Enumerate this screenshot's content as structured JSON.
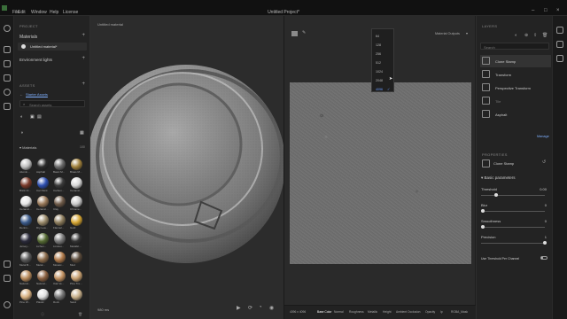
{
  "app": {
    "title": "Untitled Project*",
    "menu": [
      "File",
      "Edit",
      "Window",
      "Help",
      "License"
    ]
  },
  "left_panel": {
    "project_header": "PROJECT",
    "materials_label": "Materials",
    "material_item": "Untitled material*",
    "env_label": "Environment lights",
    "assets_header": "ASSETS",
    "breadcrumb": "Starter Assets",
    "search_placeholder": "Search assets",
    "materials_section": "Materials",
    "materials_count": "100",
    "materials": [
      {
        "name": "Alumin..."
      },
      {
        "name": "Asphalt"
      },
      {
        "name": "Basic M..."
      },
      {
        "name": "Brass M..."
      },
      {
        "name": "Brick Cl..."
      },
      {
        "name": "Car Paint"
      },
      {
        "name": "Carbon..."
      },
      {
        "name": "Ceramic..."
      },
      {
        "name": "Ceramic..."
      },
      {
        "name": "Ceramic..."
      },
      {
        "name": "Clay"
      },
      {
        "name": "Chrome..."
      },
      {
        "name": "Denim..."
      },
      {
        "name": "Dry Lea..."
      },
      {
        "name": "Flannel..."
      },
      {
        "name": "Gold"
      },
      {
        "name": "Jersey..."
      },
      {
        "name": "Lichen..."
      },
      {
        "name": "Linoleu..."
      },
      {
        "name": "Metallic..."
      },
      {
        "name": "Metal B..."
      },
      {
        "name": "Metal..."
      },
      {
        "name": "Mosaic..."
      },
      {
        "name": "Mud"
      },
      {
        "name": "Natural..."
      },
      {
        "name": "Natural..."
      },
      {
        "name": "Oak Ve..."
      },
      {
        "name": "Pine Tre..."
      },
      {
        "name": "Pine W..."
      },
      {
        "name": "Plastic"
      },
      {
        "name": "Rock"
      },
      {
        "name": "Sand"
      }
    ]
  },
  "viewport": {
    "title": "Untitled material",
    "status": "980 ms"
  },
  "toolbar": {
    "resolution": "4096",
    "resolution2": "4096"
  },
  "dropdown": {
    "options": [
      "64",
      "128",
      "256",
      "512",
      "1024",
      "2048",
      "4096"
    ],
    "selected": "4096"
  },
  "view2d": {
    "channel": "Material Outputs",
    "size_label": "4096 x 4096",
    "tabs": [
      "Base Color",
      "Normal",
      "Roughness",
      "Metallic",
      "Height",
      "Ambient Occlusion",
      "Opacity",
      "Ip",
      "RGBA_Mask"
    ]
  },
  "right_panel": {
    "layers_header": "LAYERS",
    "search_placeholder": "Search",
    "layers": [
      {
        "name": "Clone Stamp"
      },
      {
        "name": "Transform"
      },
      {
        "name": "Perspective Transform"
      },
      {
        "name": "Tile"
      },
      {
        "name": "Asphalt"
      }
    ],
    "more_link": "Manage",
    "properties_header": "PROPERTIES",
    "prop_item": "Clone Stamp",
    "section": "Basic parameters",
    "params": [
      {
        "label": "Threshold",
        "value": "0.00",
        "level": 0.22
      },
      {
        "label": "Blur",
        "value": "0",
        "level": 0.0
      },
      {
        "label": "Smoothness",
        "value": "0",
        "level": 0.0
      },
      {
        "label": "Precision",
        "value": "1",
        "level": 1.0
      }
    ],
    "toggle_label": "Use Threshold Per Channel"
  }
}
